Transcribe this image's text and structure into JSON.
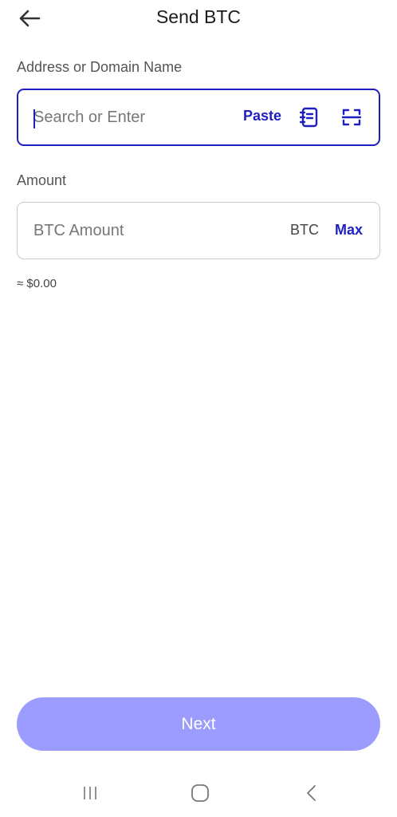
{
  "header": {
    "title": "Send BTC",
    "back_icon": "arrow-left-icon"
  },
  "address": {
    "label": "Address or Domain Name",
    "value": "",
    "placeholder": "Search or Enter",
    "paste_label": "Paste",
    "address_book_icon": "address-book-icon",
    "scan_icon": "scan-qr-icon"
  },
  "amount": {
    "label": "Amount",
    "value": "",
    "placeholder": "BTC Amount",
    "unit": "BTC",
    "max_label": "Max",
    "fiat_equivalent": "≈ $0.00"
  },
  "next_label": "Next",
  "nav": {
    "recents_icon": "recent-apps-icon",
    "home_icon": "home-icon",
    "back_icon": "nav-back-icon"
  },
  "colors": {
    "accent": "#1e1fbf",
    "button_disabled": "#9c9cff",
    "text": "#1f1f1f",
    "muted": "#555555"
  }
}
